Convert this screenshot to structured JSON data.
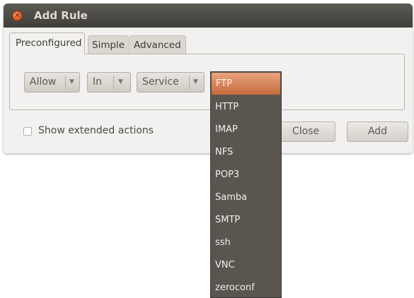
{
  "window": {
    "title": "Add Rule"
  },
  "tabs": [
    {
      "label": "Preconfigured",
      "active": true
    },
    {
      "label": "Simple",
      "active": false
    },
    {
      "label": "Advanced",
      "active": false
    }
  ],
  "combos": {
    "policy": {
      "value": "Allow"
    },
    "direction": {
      "value": "In"
    },
    "category": {
      "value": "Service"
    }
  },
  "extended_actions": {
    "label": "Show extended actions",
    "checked": false
  },
  "buttons": {
    "close": "Close",
    "add": "Add"
  },
  "dropdown": {
    "selected": "FTP",
    "options": [
      "FTP",
      "HTTP",
      "IMAP",
      "NFS",
      "POP3",
      "Samba",
      "SMTP",
      "ssh",
      "VNC",
      "zeroconf"
    ]
  },
  "colors": {
    "titlebar": "#403e39",
    "close_button": "#e3561f",
    "selection_accent": "#c46b3b",
    "dropdown_background": "#5a554f"
  },
  "icons": {
    "window_close": "close-icon",
    "combo_arrow": "triangle-down-icon"
  }
}
